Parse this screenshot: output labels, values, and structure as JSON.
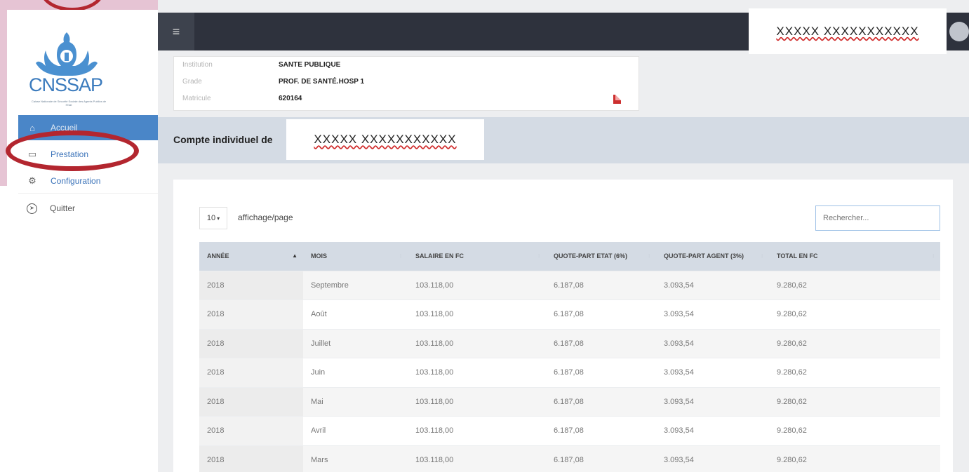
{
  "logo": {
    "text": "CNSSAP",
    "subtitle": "Caisse Nationale de Sécurité Sociale des Agents Publics de l'Etat"
  },
  "sidebar": {
    "items": [
      {
        "label": "Accueil",
        "icon": "home-icon"
      },
      {
        "label": "Prestation",
        "icon": "folder-icon"
      },
      {
        "label": "Configuration",
        "icon": "gear-icon"
      },
      {
        "label": "Quitter",
        "icon": "compass-icon"
      }
    ]
  },
  "header": {
    "menu_icon": "≡",
    "user_name": "XXXXX XXXXXXXXXXX"
  },
  "info": {
    "rows": [
      {
        "label": "Institution",
        "value": "SANTE PUBLIQUE"
      },
      {
        "label": "Grade",
        "value": "PROF. DE SANTÉ.HOSP 1"
      },
      {
        "label": "Matricule",
        "value": "620164"
      }
    ]
  },
  "compte": {
    "label": "Compte individuel de",
    "name": "XXXXX XXXXXXXXXXX"
  },
  "table_controls": {
    "page_length": "10",
    "page_length_label": "affichage/page",
    "search_placeholder": "Rechercher..."
  },
  "table": {
    "columns": [
      "ANNÉE",
      "MOIS",
      "SALAIRE EN FC",
      "QUOTE-PART ETAT (6%)",
      "QUOTE-PART AGENT (3%)",
      "TOTAL EN FC"
    ],
    "rows": [
      [
        "2018",
        "Septembre",
        "103.118,00",
        "6.187,08",
        "3.093,54",
        "9.280,62"
      ],
      [
        "2018",
        "Août",
        "103.118,00",
        "6.187,08",
        "3.093,54",
        "9.280,62"
      ],
      [
        "2018",
        "Juillet",
        "103.118,00",
        "6.187,08",
        "3.093,54",
        "9.280,62"
      ],
      [
        "2018",
        "Juin",
        "103.118,00",
        "6.187,08",
        "3.093,54",
        "9.280,62"
      ],
      [
        "2018",
        "Mai",
        "103.118,00",
        "6.187,08",
        "3.093,54",
        "9.280,62"
      ],
      [
        "2018",
        "Avril",
        "103.118,00",
        "6.187,08",
        "3.093,54",
        "9.280,62"
      ],
      [
        "2018",
        "Mars",
        "103.118,00",
        "6.187,08",
        "3.093,54",
        "9.280,62"
      ]
    ]
  },
  "colors": {
    "accent": "#4a86c8",
    "topbar": "#2e323d",
    "highlight_ring": "#b3262f"
  }
}
